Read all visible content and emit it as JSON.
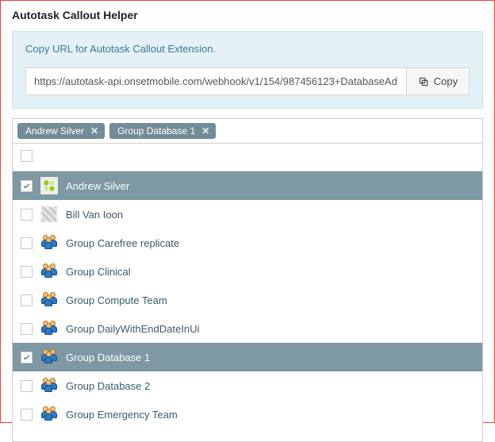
{
  "header": {
    "title": "Autotask Callout Helper"
  },
  "info": {
    "text": "Copy URL for Autotask Callout Extension.",
    "url": "https://autotask-api.onsetmobile.com/webhook/v1/154/987456123+DatabaseAd",
    "copy_label": "Copy"
  },
  "tags": [
    {
      "label": "Andrew Silver"
    },
    {
      "label": "Group Database 1"
    }
  ],
  "list": {
    "select_all_checked": false,
    "items": [
      {
        "label": "Andrew Silver",
        "checked": true,
        "icon": "user-green"
      },
      {
        "label": "Bill Van Ioon",
        "checked": false,
        "icon": "user-grey"
      },
      {
        "label": "Group Carefree replicate",
        "checked": false,
        "icon": "group"
      },
      {
        "label": "Group Clinical",
        "checked": false,
        "icon": "group"
      },
      {
        "label": "Group Compute Team",
        "checked": false,
        "icon": "group"
      },
      {
        "label": "Group DailyWithEndDateInUi",
        "checked": false,
        "icon": "group"
      },
      {
        "label": "Group Database 1",
        "checked": true,
        "icon": "group"
      },
      {
        "label": "Group Database 2",
        "checked": false,
        "icon": "group"
      },
      {
        "label": "Group Emergency Team",
        "checked": false,
        "icon": "group"
      }
    ]
  }
}
